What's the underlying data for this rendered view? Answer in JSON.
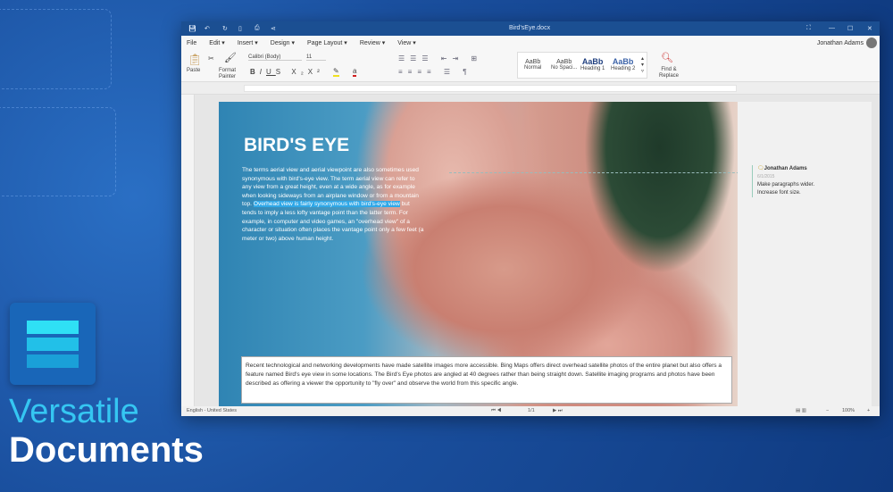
{
  "branding": {
    "tagline_line1": "Versatile",
    "tagline_line2": "Documents",
    "logo_colors": [
      "#2fe0f5",
      "#22c0e8",
      "#1aa0d8"
    ]
  },
  "window": {
    "title": "Bird'sEye.docx",
    "user": "Jonathan Adams"
  },
  "menu": [
    "File",
    "Edit ▾",
    "Insert ▾",
    "Design ▾",
    "Page Layout ▾",
    "Review ▾",
    "View ▾"
  ],
  "ribbon": {
    "paste": "Paste",
    "format_painter": "Format Painter",
    "font": "Calibri (Body)",
    "size": "11",
    "styles": [
      {
        "sample": "AaBb",
        "name": "Normal"
      },
      {
        "sample": "AaBb",
        "name": "No Spaci..."
      },
      {
        "sample": "AaBb",
        "name": "Heading 1"
      },
      {
        "sample": "AaBb",
        "name": "Heading 2"
      }
    ],
    "find_replace": "Find & Replace"
  },
  "document": {
    "heading": "BIRD'S EYE",
    "para_a": "The terms aerial view and aerial viewpoint are also sometimes used synonymous with bird's-eye view. The term aerial view can refer to any view from a great height, even at a wide angle, as for example when looking sideways from an airplane window or from a mountain top. ",
    "para_highlight": "Overhead view is fairly synonymous with bird's-eye view",
    "para_b": " but tends to imply a less lofty vantage point than the latter term. For example, in computer and video games, an \"overhead view\" of a character or situation often places the vantage point only a few feet (a meter or two) above human height.",
    "caption": "Recent technological and networking developments have made satellite images more accessible. Bing Maps offers direct overhead satellite photos of the entire planet but also offers a feature named Bird's eye view in some locations. The Bird's Eye photos are angled at 40 degrees rather than being straight down. Satellite imaging programs and photos have been described as offering a viewer the opportunity to \"fly over\" and observe the world from this specific angle."
  },
  "comment": {
    "author": "Jonathan Adams",
    "date": "6/1/2015",
    "text": "Make paragraphs wider. Increase font size."
  },
  "status": {
    "language": "English - United States",
    "page": "1/1",
    "zoom": "100%"
  }
}
